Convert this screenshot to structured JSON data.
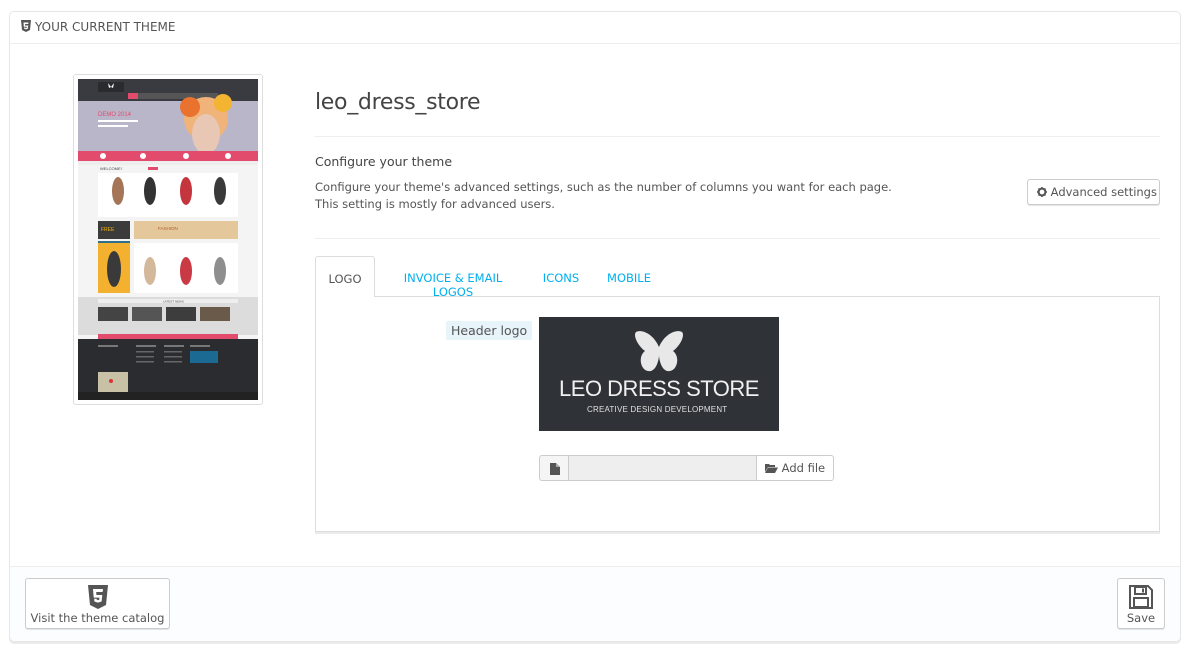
{
  "panel": {
    "heading": "YOUR CURRENT THEME",
    "heading_icon": "html5-icon"
  },
  "theme": {
    "name": "leo_dress_store",
    "configure_title": "Configure your theme",
    "configure_desc_line1": "Configure your theme's advanced settings, such as the number of columns you want for each page.",
    "configure_desc_line2": "This setting is mostly for advanced users.",
    "advanced_button": "Advanced settings",
    "advanced_icon": "gear-icon"
  },
  "tabs": [
    {
      "label": "LOGO",
      "active": true
    },
    {
      "label": "INVOICE & EMAIL LOGOS",
      "active": false
    },
    {
      "label": "ICONS",
      "active": false
    },
    {
      "label": "MOBILE",
      "active": false
    }
  ],
  "logo_tab": {
    "header_logo_label": "Header logo",
    "logo_title": "LEO DRESS STORE",
    "logo_subtitle": "CREATIVE DESIGN DEVELOPMENT",
    "add_file_button": "Add file",
    "file_value": ""
  },
  "thumbnail": {
    "banner_text": "DEMO 2014",
    "welcome_text": "WELCOME!",
    "fashion_text": "FASHION",
    "free_text": "FREE",
    "latest_text": "LATEST NEWS"
  },
  "footer": {
    "catalog_button": "Visit the theme catalog",
    "save_button": "Save"
  },
  "colors": {
    "accent": "#00aff0",
    "thumb_pink": "#e24b6c",
    "thumb_dark": "#2b2c30"
  }
}
